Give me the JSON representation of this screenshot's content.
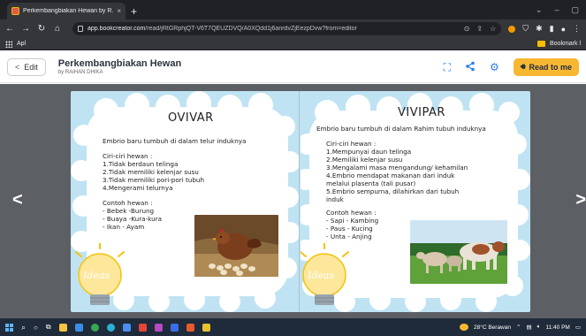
{
  "browser": {
    "tab_title": "Perkembangbiakan Hewan by R...",
    "tab_close": "×",
    "new_tab": "+",
    "url_domain": "app.bookcreator.com",
    "url_path": "/read/jRtGRphjQT-V6T7QEUZDVQ/A0XQdd1j6anrdvZjEezpDvw?from=editor",
    "bookmark_apps": "Apl",
    "bookmark_folder": "Bookmark l"
  },
  "header": {
    "edit_label": "Edit",
    "book_title": "Perkembangbiakan Hewan",
    "book_author": "by RAIHAN DHIKA",
    "read_label": "Read to me"
  },
  "left_page": {
    "title": "OVIVAR",
    "lines": [
      "Embrio baru tumbuh di dalam telur induknya",
      "",
      "Ciri-ciri hewan :",
      "1.Tidak berdaun telinga",
      "2.Tidak memiliki kelenjar susu",
      "3.Tidak memiliki pori-pori tubuh",
      "4.Mengerami telurnya",
      "",
      "Contoh hewan :",
      "- Bebek -Burung",
      "- Buaya -Kura-kura",
      "- Ikan   - Ayam"
    ],
    "ideas_text": "Ideas"
  },
  "right_page": {
    "title": "VIVIPAR",
    "lines": [
      "Embrio baru tumbuh di dalam Rahim tubuh induknya",
      "",
      "Ciri-ciri hewan :",
      "1.Mempunyai daun telinga",
      "2.Memiliki kelenjar susu",
      "3.Mengalami masa mengandung/ kehamilan",
      "4.Embrio mendapat makanan dari induk",
      "melalui plasenta (tali pusar)",
      "5.Embrio sempurna, dilahirkan dari tubuh",
      "induk",
      "",
      "Contoh hewan :",
      " - Sapi  - Kambing",
      " - Paus  - Kucing",
      " - Unta  - Anjing"
    ],
    "ideas_text": "Ideas"
  },
  "taskbar": {
    "weather": "28°C  Berawan",
    "time": "11:40 PM"
  },
  "colors": {
    "accent_blue": "#2b7de9",
    "read_button": "#f7b731",
    "page_bg": "#bfe3f3",
    "stage_bg": "#5c5f63"
  }
}
